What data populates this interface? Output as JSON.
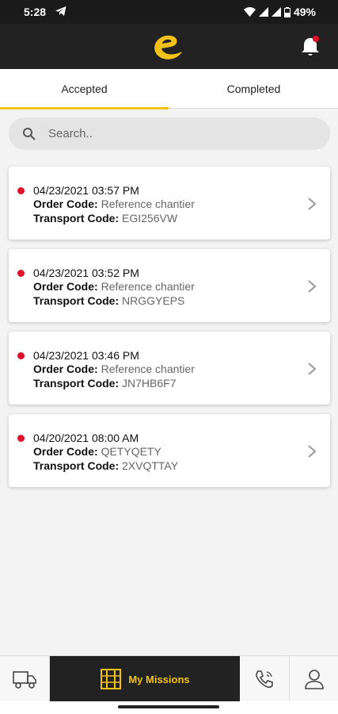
{
  "status_bar": {
    "time": "5:28",
    "battery": "49%"
  },
  "tabs": [
    {
      "label": "Accepted",
      "active": true
    },
    {
      "label": "Completed",
      "active": false
    }
  ],
  "search": {
    "placeholder": "Search.."
  },
  "missions": [
    {
      "date": "04/23/2021 03:57 PM",
      "order_label": "Order Code:",
      "order_code": "Reference chantier",
      "transport_label": "Transport Code:",
      "transport_code": "EGI256VW"
    },
    {
      "date": "04/23/2021 03:52 PM",
      "order_label": "Order Code:",
      "order_code": "Reference chantier",
      "transport_label": "Transport Code:",
      "transport_code": "NRGGYEPS"
    },
    {
      "date": "04/23/2021 03:46 PM",
      "order_label": "Order Code:",
      "order_code": "Reference chantier",
      "transport_label": "Transport Code:",
      "transport_code": "JN7HB6F7"
    },
    {
      "date": "04/20/2021 08:00 AM",
      "order_label": "Order Code:",
      "order_code": "QETYQETY",
      "transport_label": "Transport Code:",
      "transport_code": "2XVQTTAY"
    }
  ],
  "bottom_nav": {
    "missions_label": "My Missions"
  },
  "colors": {
    "accent": "#f2c21b",
    "dark": "#222222",
    "status_dot": "#e0112b"
  }
}
